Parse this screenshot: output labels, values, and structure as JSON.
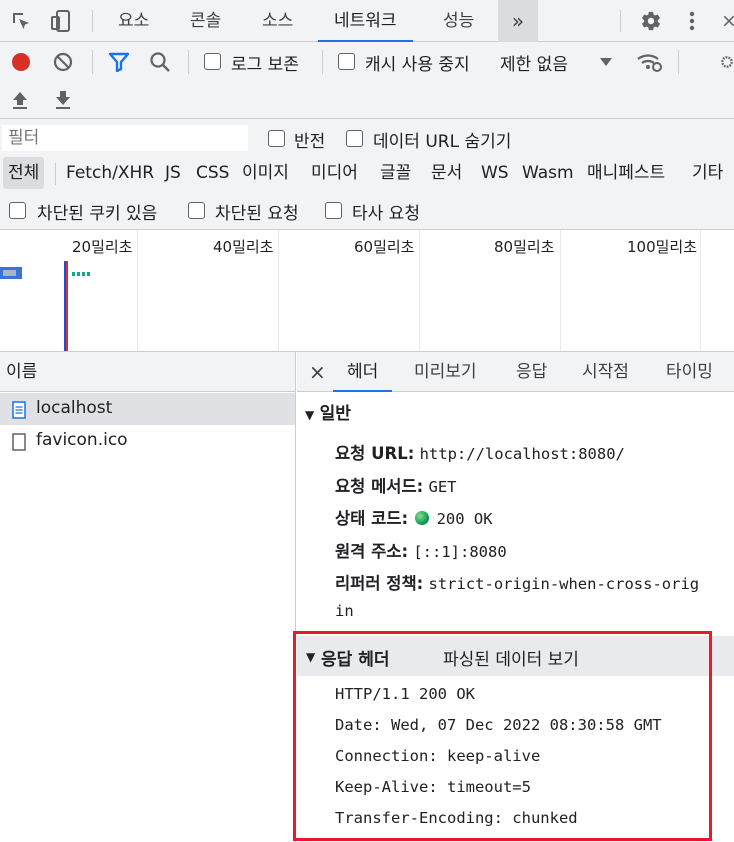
{
  "panel_tabs": [
    "요소",
    "콘솔",
    "소스",
    "네트워크",
    "성능"
  ],
  "active_tab": "네트워크",
  "more_tabs_label": "»",
  "toolbar2": {
    "preserve_log": "로그 보존",
    "disable_cache": "캐시 사용 중지",
    "throttling": "제한 없음"
  },
  "filter": {
    "placeholder": "필터",
    "invert": "반전",
    "hide_data_urls": "데이터 URL 숨기기"
  },
  "type_filters": [
    "전체",
    "Fetch/XHR",
    "JS",
    "CSS",
    "이미지",
    "미디어",
    "글꼴",
    "문서",
    "WS",
    "Wasm",
    "매니페스트",
    "기타"
  ],
  "selected_type": "전체",
  "extra_filters": [
    "차단된 쿠키 있음",
    "차단된 요청",
    "타사 요청"
  ],
  "timeline_ticks": [
    "20밀리초",
    "40밀리초",
    "60밀리초",
    "80밀리초",
    "100밀리초"
  ],
  "requests": {
    "header": "이름",
    "items": [
      "localhost",
      "favicon.ico"
    ]
  },
  "detail_tabs": [
    "헤더",
    "미리보기",
    "응답",
    "시작점",
    "타이밍"
  ],
  "close_label": "×",
  "general": {
    "title": "일반",
    "rows": [
      {
        "key": "요청 URL:",
        "value": "http://localhost:8080/"
      },
      {
        "key": "요청 메서드:",
        "value": "GET"
      },
      {
        "key": "상태 코드:",
        "value": "200 OK"
      },
      {
        "key": "원격 주소:",
        "value": "[::1]:8080"
      },
      {
        "key": "리퍼러 정책:",
        "value": "strict-origin-when-cross-orig"
      }
    ],
    "policy_wrap": "in"
  },
  "response_headers": {
    "title": "응답 헤더",
    "parsed_toggle": "파싱된 데이터 보기",
    "lines": [
      "HTTP/1.1 200 OK",
      "Date: Wed, 07 Dec 2022 08:30:58 GMT",
      "Connection: keep-alive",
      "Keep-Alive: timeout=5",
      "Transfer-Encoding: chunked"
    ]
  },
  "colors": {
    "accent": "#1a73e8",
    "record": "#d93025",
    "status_ok": "#0f9d58",
    "highlight": "#e8192c"
  }
}
